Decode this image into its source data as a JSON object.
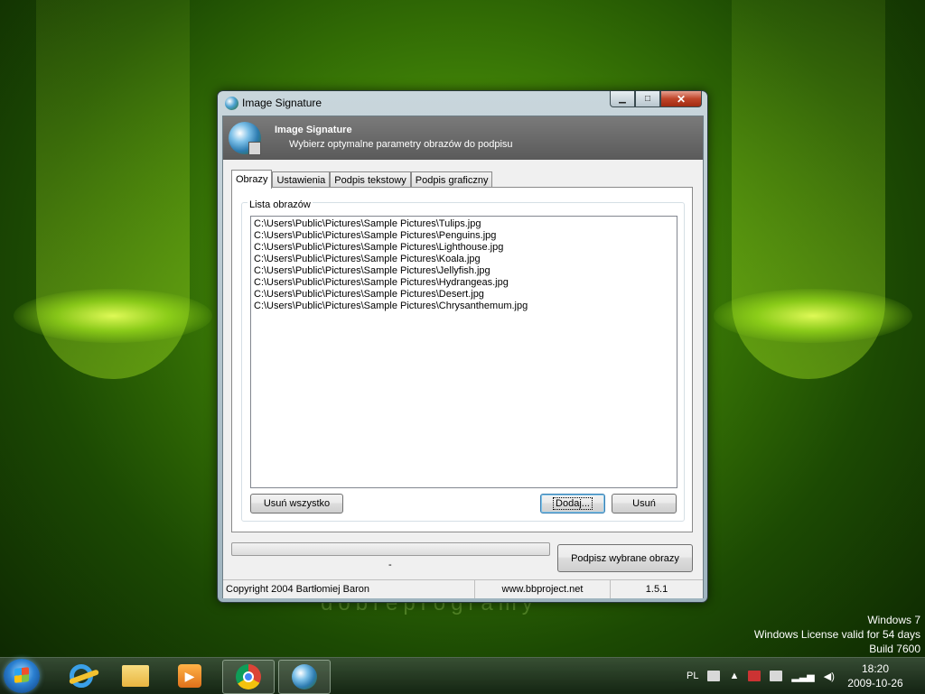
{
  "window": {
    "title": "Image Signature",
    "buttons": {
      "minimize": "▁",
      "maximize": "□",
      "close": "✕"
    }
  },
  "header": {
    "title": "Image Signature",
    "subtitle": "Wybierz optymalne parametry obrazów do podpisu"
  },
  "tabs": [
    {
      "label": "Obrazy",
      "active": true
    },
    {
      "label": "Ustawienia",
      "active": false
    },
    {
      "label": "Podpis tekstowy",
      "active": false
    },
    {
      "label": "Podpis graficzny",
      "active": false
    }
  ],
  "images_panel": {
    "group_label": "Lista obrazów",
    "files": [
      "C:\\Users\\Public\\Pictures\\Sample Pictures\\Tulips.jpg",
      "C:\\Users\\Public\\Pictures\\Sample Pictures\\Penguins.jpg",
      "C:\\Users\\Public\\Pictures\\Sample Pictures\\Lighthouse.jpg",
      "C:\\Users\\Public\\Pictures\\Sample Pictures\\Koala.jpg",
      "C:\\Users\\Public\\Pictures\\Sample Pictures\\Jellyfish.jpg",
      "C:\\Users\\Public\\Pictures\\Sample Pictures\\Hydrangeas.jpg",
      "C:\\Users\\Public\\Pictures\\Sample Pictures\\Desert.jpg",
      "C:\\Users\\Public\\Pictures\\Sample Pictures\\Chrysanthemum.jpg"
    ],
    "remove_all_label": "Usuń wszystko",
    "add_label": "Dodaj...",
    "remove_label": "Usuń"
  },
  "progress": {
    "value": 0,
    "status_text": "-"
  },
  "sign_button_label": "Podpisz wybrane obrazy",
  "statusbar": {
    "copyright": "Copyright 2004 Bartłomiej Baron",
    "website": "www.bbproject.net",
    "version": "1.5.1"
  },
  "desktop": {
    "os_name": "Windows 7",
    "license": "Windows License valid for 54 days",
    "build": "Build 7600",
    "watermark": "dobreprogramy"
  },
  "taskbar": {
    "items": [
      "start-button",
      "internet-explorer",
      "windows-explorer",
      "media-player",
      "google-chrome",
      "image-signature"
    ],
    "language": "PL",
    "time": "18:20",
    "date": "2009-10-26"
  }
}
